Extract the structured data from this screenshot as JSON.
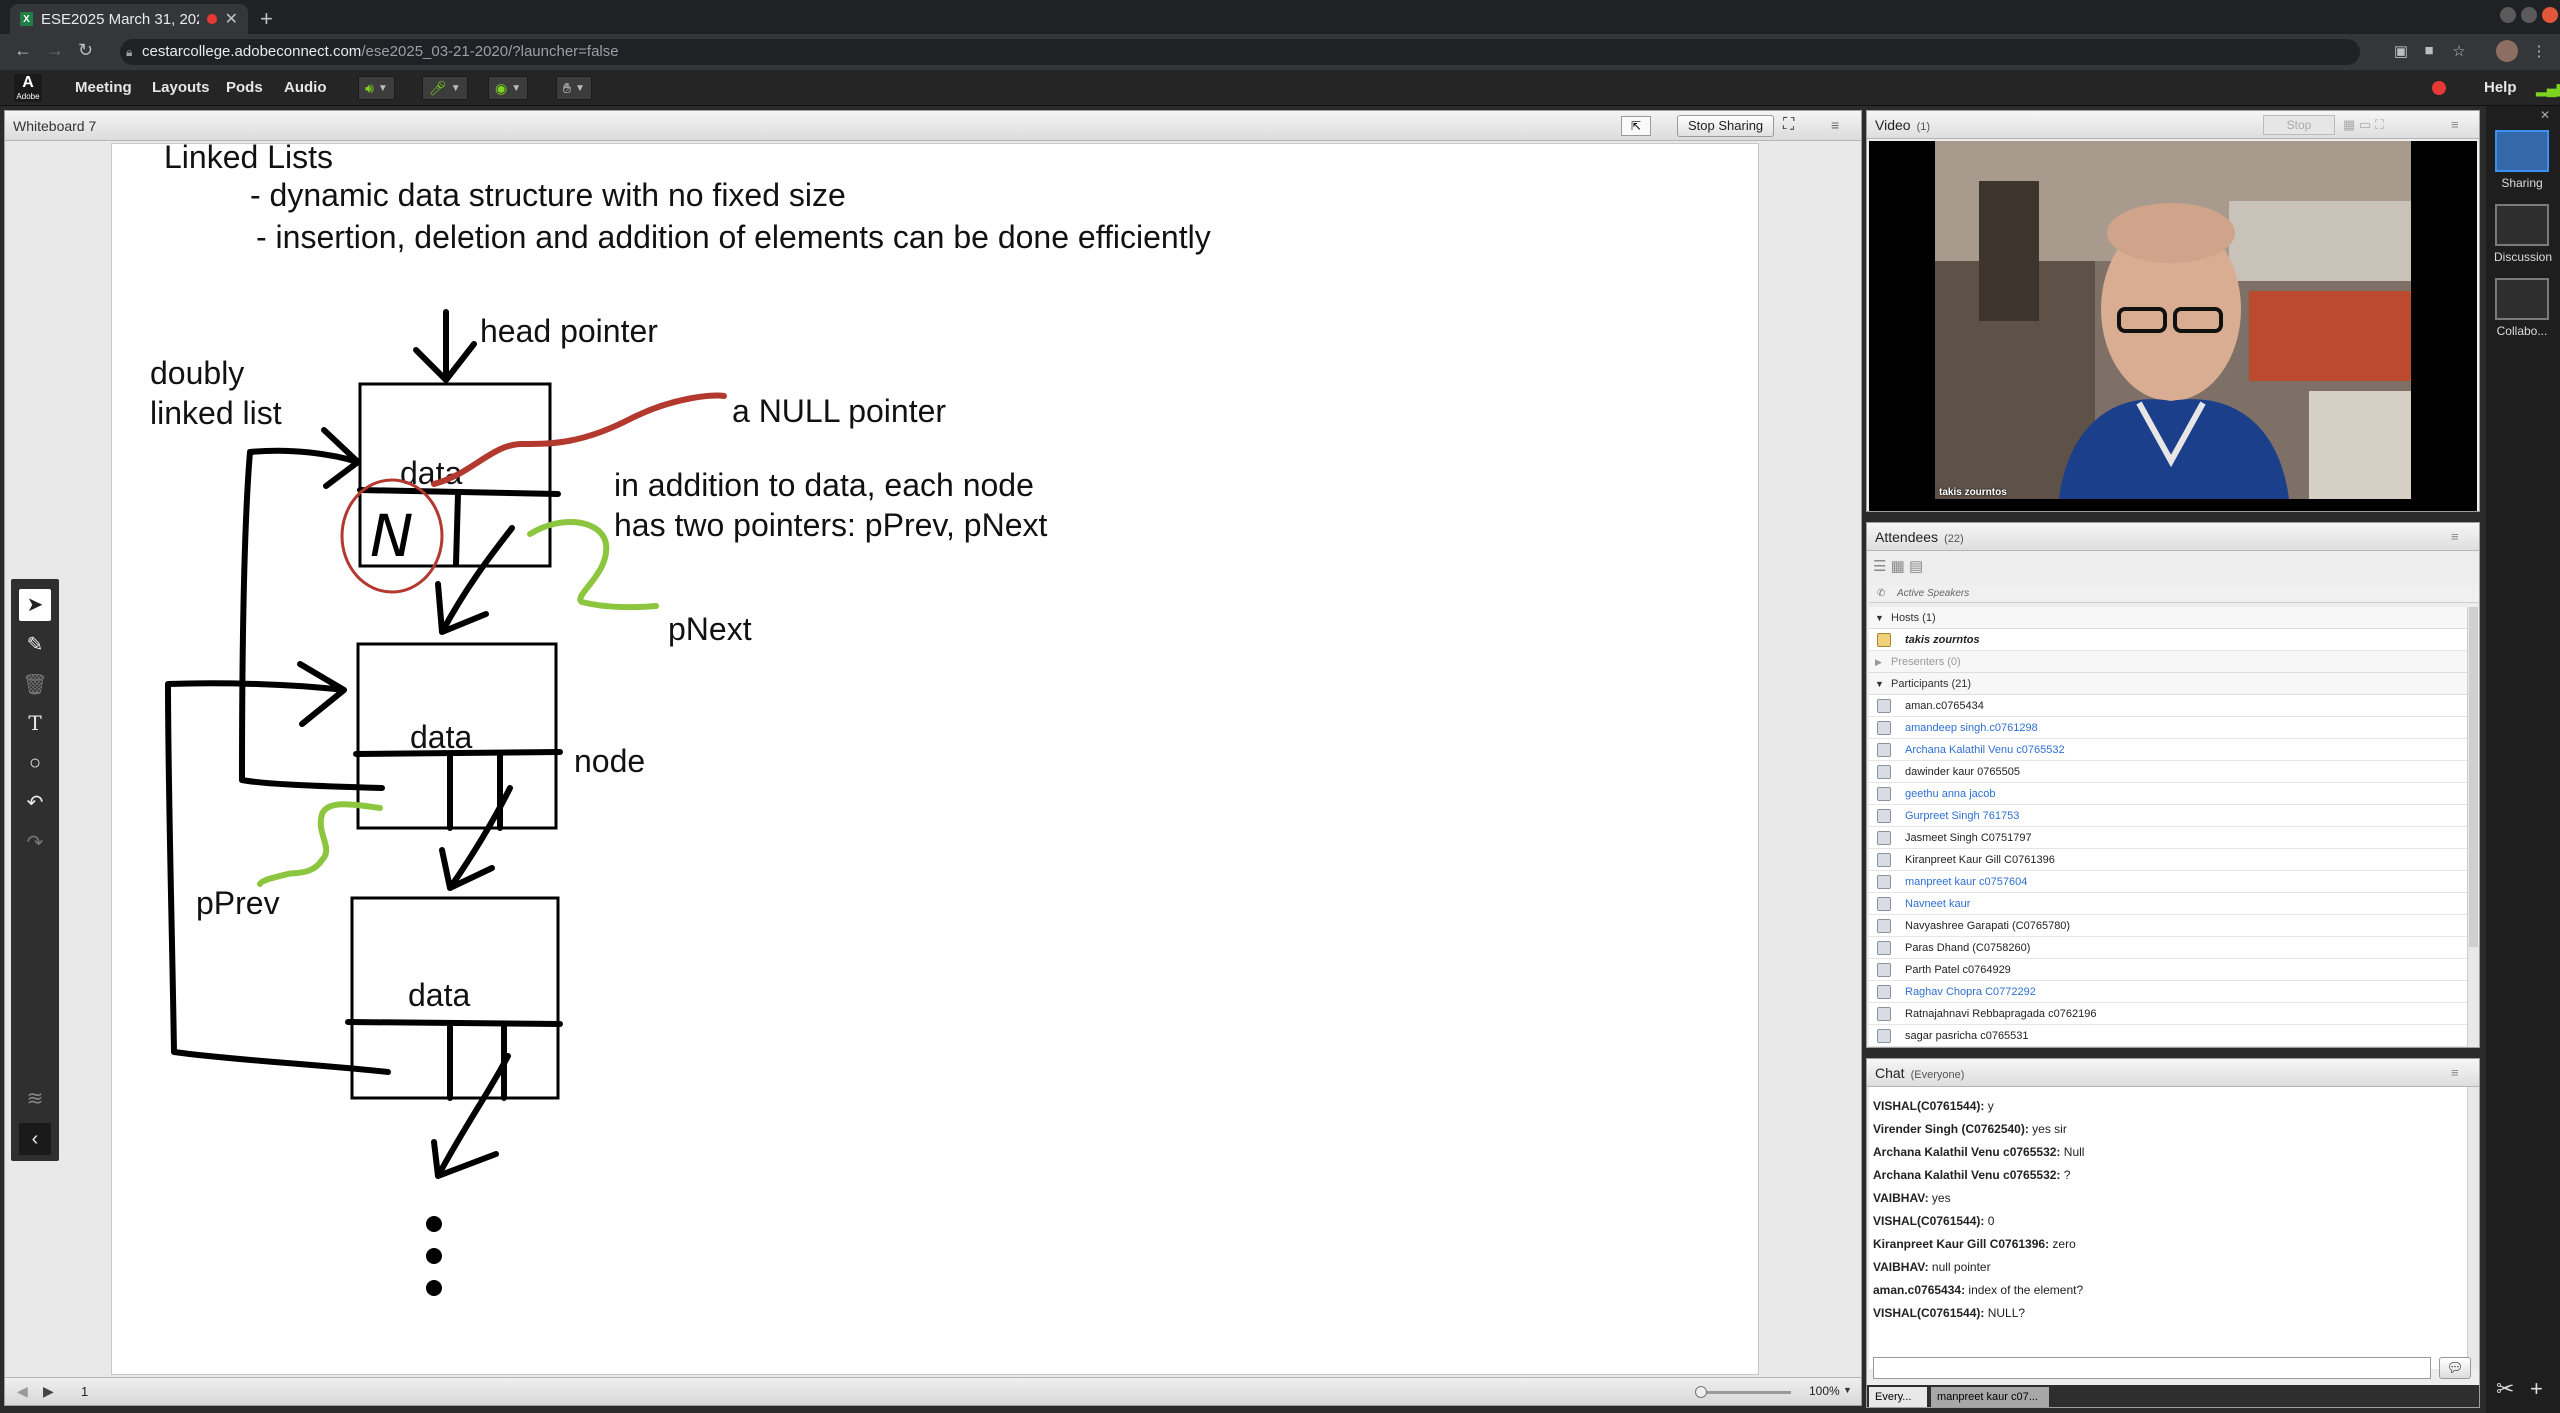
{
  "browser": {
    "tab_title": "ESE2025 March 31, 202",
    "tab_favicon": "X",
    "url_host": "cestarcollege.adobeconnect.com",
    "url_path": "/ese2025_03-21-2020/?launcher=false"
  },
  "menu": {
    "logo": "Adobe",
    "items": [
      "Meeting",
      "Layouts",
      "Pods",
      "Audio"
    ],
    "help": "Help"
  },
  "whiteboard": {
    "title": "Whiteboard 7",
    "stop_sharing": "Stop Sharing",
    "page_number": "1",
    "zoom": "100%",
    "text": {
      "title": "Linked Lists",
      "bullet1": "- dynamic data structure with no fixed size",
      "bullet2": "- insertion, deletion and addition of elements can be done efficiently",
      "head_pointer": "head pointer",
      "doubly": "doubly",
      "linked_list": "linked list",
      "null_pointer": "a NULL pointer",
      "addition1": "in addition to data, each node",
      "addition2": "has two pointers: pPrev, pNext",
      "pnext": "pNext",
      "node": "node",
      "pprev": "pPrev",
      "data1": "data",
      "data2": "data",
      "data3": "data",
      "null_letter": "N"
    }
  },
  "video": {
    "title": "Video",
    "count": "(1)",
    "stop": "Stop",
    "presenter_name": "takis zourntos"
  },
  "attendees": {
    "title": "Attendees",
    "count": "(22)",
    "active_speakers": "Active Speakers",
    "hosts_label": "Hosts (1)",
    "host": "takis zourntos",
    "presenters_label": "Presenters (0)",
    "participants_label": "Participants (21)",
    "participants": [
      {
        "name": "aman.c0765434",
        "active": false
      },
      {
        "name": "amandeep singh.c0761298",
        "active": true
      },
      {
        "name": "Archana Kalathil Venu c0765532",
        "active": true
      },
      {
        "name": "dawinder kaur 0765505",
        "active": false
      },
      {
        "name": "geethu anna jacob",
        "active": true
      },
      {
        "name": "Gurpreet Singh 761753",
        "active": true
      },
      {
        "name": "Jasmeet Singh C0751797",
        "active": false
      },
      {
        "name": "Kiranpreet Kaur Gill C0761396",
        "active": false
      },
      {
        "name": "manpreet kaur c0757604",
        "active": true
      },
      {
        "name": "Navneet kaur",
        "active": true
      },
      {
        "name": "Navyashree Garapati (C0765780)",
        "active": false
      },
      {
        "name": "Paras Dhand (C0758260)",
        "active": false
      },
      {
        "name": "Parth Patel c0764929",
        "active": false
      },
      {
        "name": "Raghav Chopra C0772292",
        "active": true
      },
      {
        "name": "Ratnajahnavi Rebbapragada c0762196",
        "active": false
      },
      {
        "name": "sagar pasricha c0765531",
        "active": false
      }
    ]
  },
  "chat": {
    "title": "Chat",
    "scope": "(Everyone)",
    "messages": [
      {
        "from": "VISHAL(C0761544):",
        "text": " y"
      },
      {
        "from": "Virender Singh (C0762540):",
        "text": " yes sir"
      },
      {
        "from": "Archana Kalathil Venu c0765532:",
        "text": " Null"
      },
      {
        "from": "Archana Kalathil Venu c0765532:",
        "text": " ?"
      },
      {
        "from": "VAIBHAV:",
        "text": " yes"
      },
      {
        "from": "VISHAL(C0761544):",
        "text": " 0"
      },
      {
        "from": "Kiranpreet Kaur Gill C0761396:",
        "text": " zero"
      },
      {
        "from": "VAIBHAV:",
        "text": " null pointer"
      },
      {
        "from": "aman.c0765434:",
        "text": " index of the element?"
      },
      {
        "from": "VISHAL(C0761544):",
        "text": " NULL?"
      }
    ],
    "tab_everyone": "Every...",
    "tab_private": "manpreet kaur c07..."
  },
  "layouts": [
    {
      "label": "Sharing",
      "selected": true
    },
    {
      "label": "Discussion",
      "selected": false
    },
    {
      "label": "Collabo...",
      "selected": false
    }
  ],
  "colors": {
    "annotation_red": "#b3392e",
    "annotation_green": "#8cc63f",
    "link_blue": "#2e6fd1",
    "layout_selected": "#3b8ff0"
  }
}
